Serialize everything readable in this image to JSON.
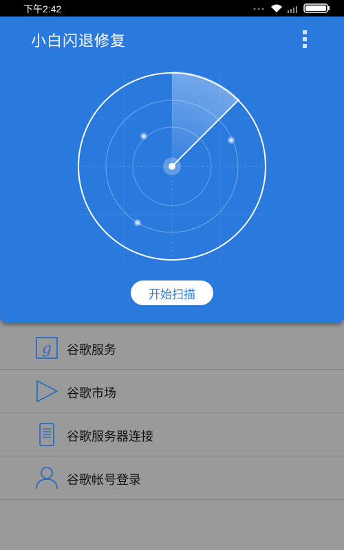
{
  "status_bar": {
    "time": "下午2:42"
  },
  "header": {
    "title": "小白闪退修复"
  },
  "scan": {
    "button_label": "开始扫描"
  },
  "menu": {
    "items": [
      {
        "label": "谷歌服务",
        "icon": "google-g-icon"
      },
      {
        "label": "谷歌市场",
        "icon": "play-store-icon"
      },
      {
        "label": "谷歌服务器连接",
        "icon": "server-icon"
      },
      {
        "label": "谷歌帐号登录",
        "icon": "user-account-icon"
      }
    ]
  },
  "colors": {
    "primary": "#2a7ade",
    "list_bg": "#9a9a9a",
    "icon_blue": "#2a6bc0"
  }
}
